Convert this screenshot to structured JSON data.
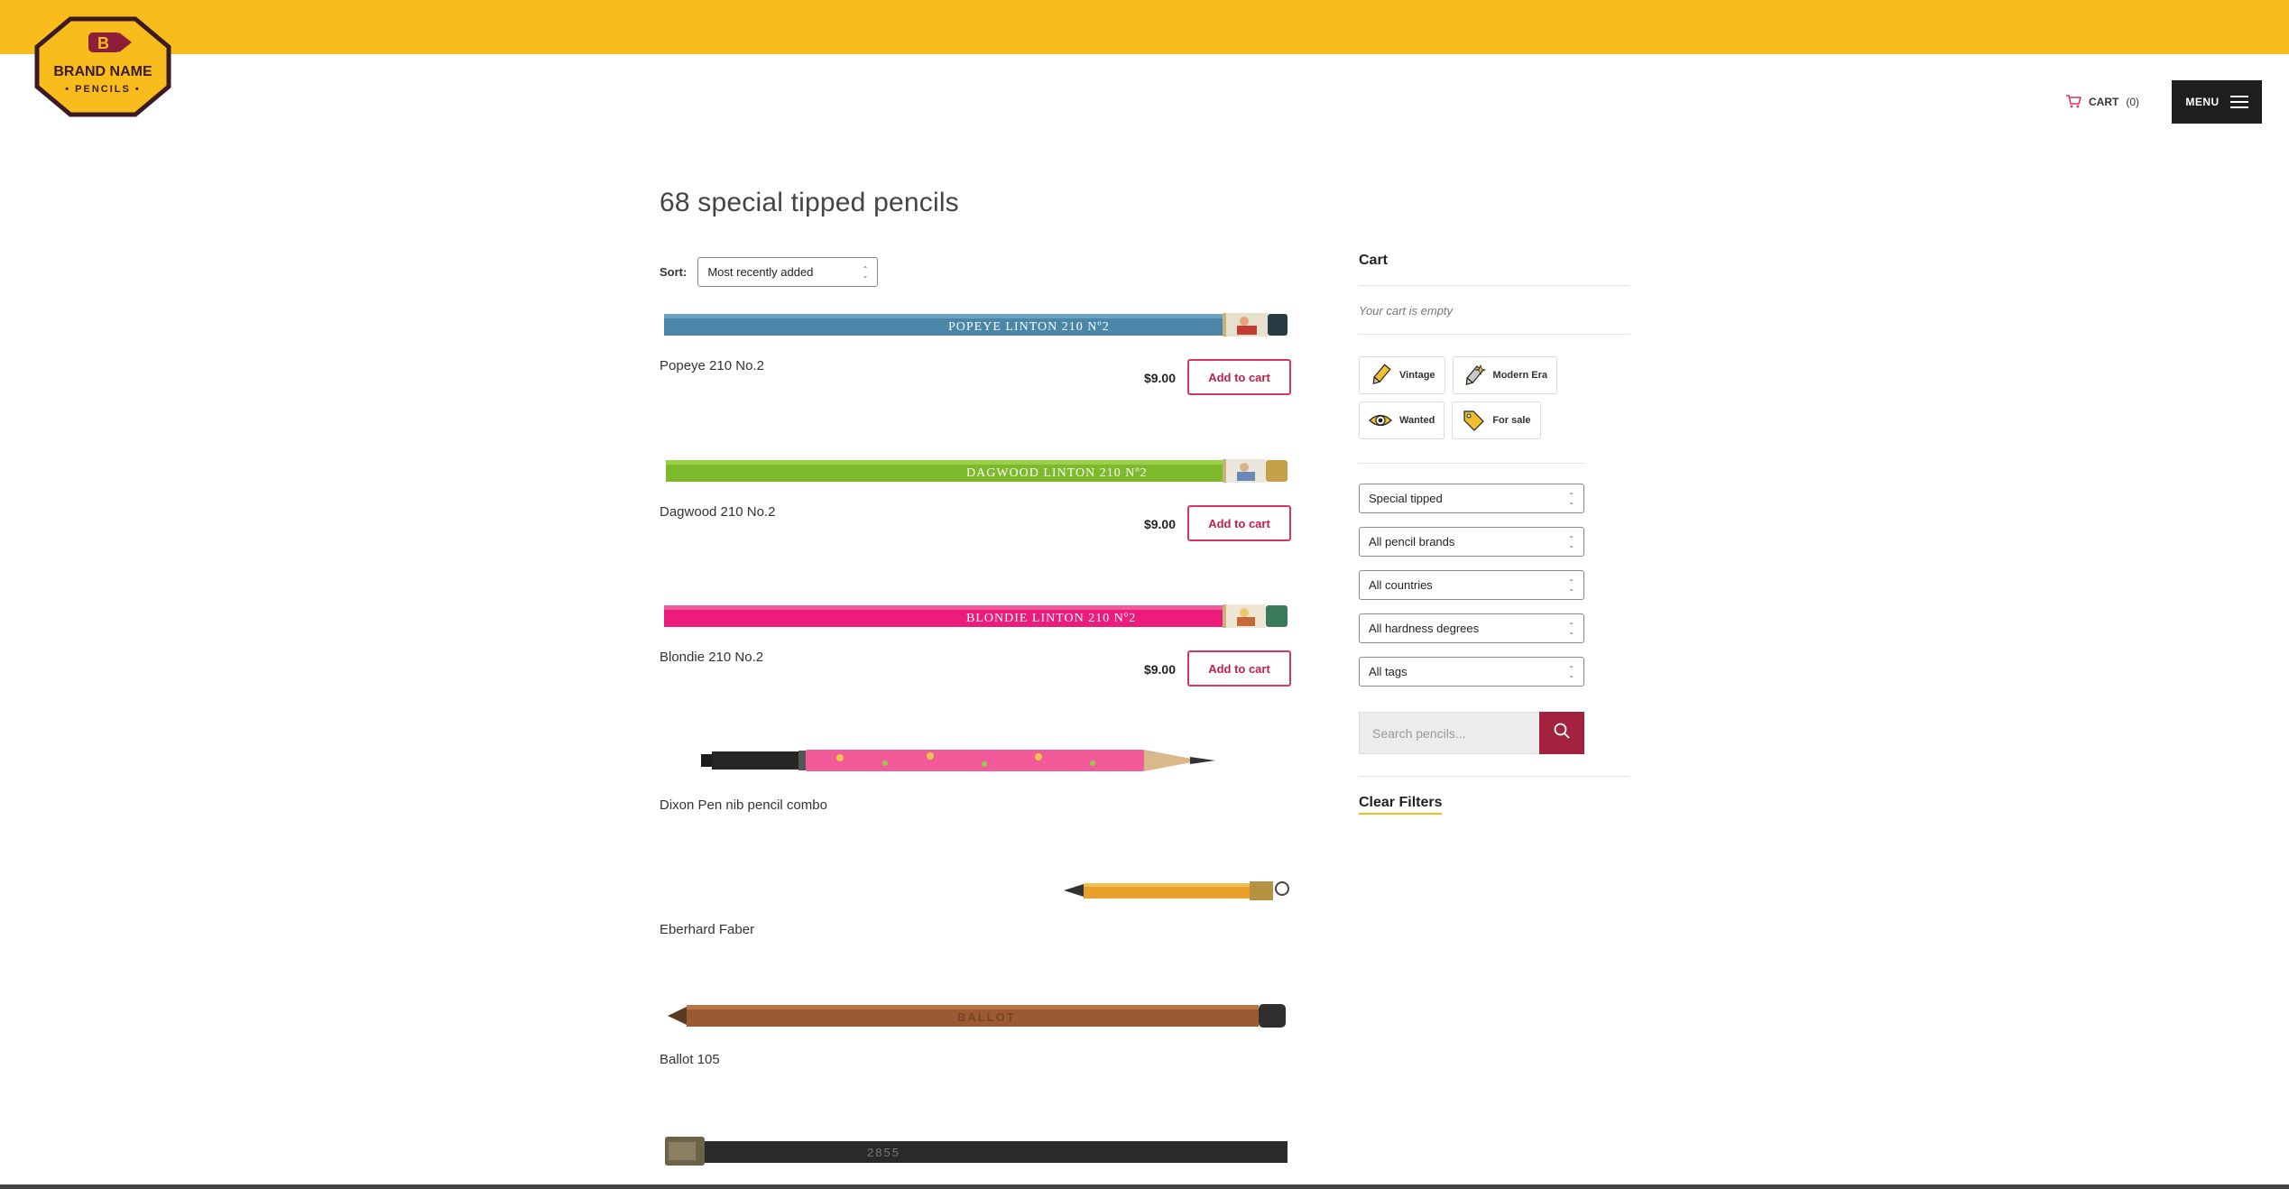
{
  "header": {
    "brand_line1": "BRAND NAME",
    "brand_line2": "• PENCILS •",
    "cart_label": "CART",
    "cart_count": "(0)",
    "menu_label": "MENU"
  },
  "listing": {
    "title": "68 special tipped pencils",
    "sort_label": "Sort:",
    "sort_value": "Most recently added"
  },
  "products": [
    {
      "name": "Popeye 210 No.2",
      "price": "$9.00",
      "button": "Add to cart",
      "imprint": "POPEYE  LINTON  210  Nº2",
      "color": "#4a86a8"
    },
    {
      "name": "Dagwood 210 No.2",
      "price": "$9.00",
      "button": "Add to cart",
      "imprint": "DAGWOOD  LINTON  210  Nº2",
      "color": "#7cba2b"
    },
    {
      "name": "Blondie 210 No.2",
      "price": "$9.00",
      "button": "Add to cart",
      "imprint": "BLONDIE  LINTON  210  Nº2",
      "color": "#ec1c7c"
    },
    {
      "name": "Dixon Pen nib pencil combo",
      "color": "#f25a9a"
    },
    {
      "name": "Eberhard Faber",
      "color": "#e8a02a"
    },
    {
      "name": "Ballot 105",
      "imprint": "BALLOT",
      "color": "#9c5a33"
    },
    {
      "name": "",
      "imprint": "2855",
      "color": "#2a2a2a"
    }
  ],
  "sidebar": {
    "cart_title": "Cart",
    "cart_empty": "Your cart is empty",
    "tags": [
      {
        "label": "Vintage",
        "icon": "pencil-vintage-icon"
      },
      {
        "label": "Modern Era",
        "icon": "pencil-sparkle-icon"
      },
      {
        "label": "Wanted",
        "icon": "eye-icon"
      },
      {
        "label": "For sale",
        "icon": "price-tag-icon"
      }
    ],
    "filters": [
      "Special tipped",
      "All pencil brands",
      "All countries",
      "All hardness degrees",
      "All tags"
    ],
    "search_placeholder": "Search pencils...",
    "clear_label": "Clear Filters"
  },
  "colors": {
    "accent_yellow": "#f8bd1c",
    "button_red": "#c12047",
    "search_button": "#a3233f",
    "menu_bg": "#1e1e1e"
  }
}
